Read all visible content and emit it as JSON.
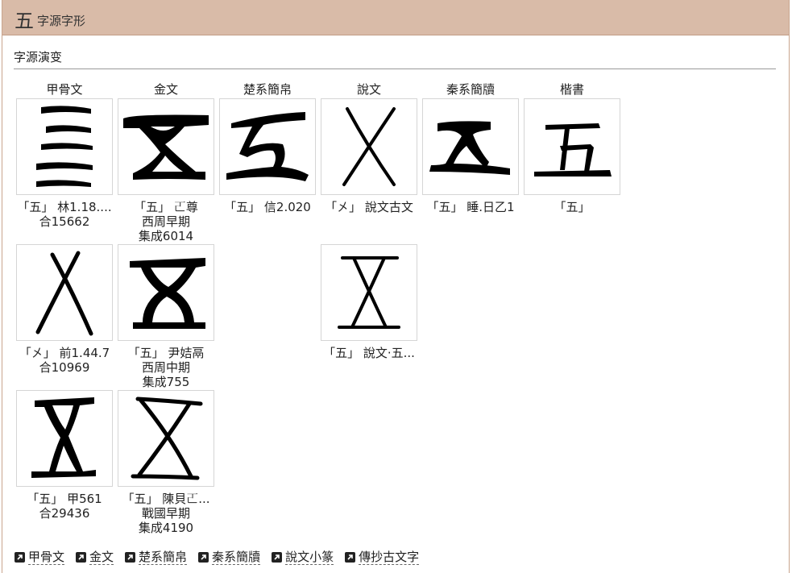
{
  "header": {
    "char": "五",
    "title": "字源字形"
  },
  "section": {
    "title": "字源演变"
  },
  "columns": [
    "甲骨文",
    "金文",
    "楚系簡帛",
    "說文",
    "秦系簡牘",
    "楷書"
  ],
  "cells": [
    {
      "icon": "oracle-five-lines-glyph",
      "cap1": "「五」 林1.18....",
      "cap2": "合15662",
      "cap3": ""
    },
    {
      "icon": "bronze-five-hourglass-glyph",
      "cap1": "「五」 𠀀尊",
      "cap2": "西周早期",
      "cap3": "集成6014"
    },
    {
      "icon": "chu-five-glyph",
      "cap1": "「五」 信2.020",
      "cap2": "",
      "cap3": ""
    },
    {
      "icon": "shuowen-x-glyph",
      "cap1": "「㐅」 說文古文",
      "cap2": "",
      "cap3": ""
    },
    {
      "icon": "qin-five-glyph",
      "cap1": "「五」 睡.日乙1",
      "cap2": "",
      "cap3": ""
    },
    {
      "icon": "kaishu-five-glyph",
      "cap1": "「五」",
      "cap2": "",
      "cap3": ""
    },
    {
      "icon": "oracle-x-glyph",
      "cap1": "「㐅」 前1.44.7",
      "cap2": "合10969",
      "cap3": ""
    },
    {
      "icon": "bronze-five-rounded-glyph",
      "cap1": "「五」 尹姞鬲",
      "cap2": "西周中期",
      "cap3": "集成755"
    },
    {
      "icon": "shuowen-five-hourglass-glyph",
      "cap1": "「五」 說文·五...",
      "cap2": "",
      "cap3": ""
    },
    {
      "icon": "oracle-five-hourglass-glyph",
      "cap1": "「五」 甲561",
      "cap2": "合29436",
      "cap3": ""
    },
    {
      "icon": "bronze-five-thin-glyph",
      "cap1": "「五」 陳貝𠀀...",
      "cap2": "戰國早期",
      "cap3": "集成4190"
    }
  ],
  "links": [
    "甲骨文",
    "金文",
    "楚系簡帛",
    "秦系簡牘",
    "說文小篆",
    "傳抄古文字"
  ]
}
